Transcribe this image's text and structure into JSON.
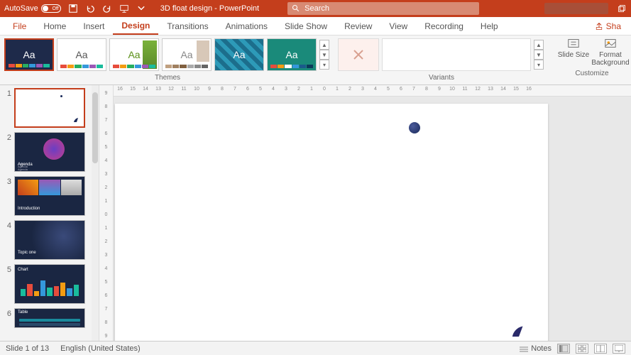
{
  "titlebar": {
    "autosave_label": "AutoSave",
    "autosave_state": "Off",
    "doc_title": "3D float design - PowerPoint",
    "search_placeholder": "Search"
  },
  "tabs": {
    "file": "File",
    "home": "Home",
    "insert": "Insert",
    "design": "Design",
    "transitions": "Transitions",
    "animations": "Animations",
    "slideshow": "Slide Show",
    "review": "Review",
    "view": "View",
    "recording": "Recording",
    "help": "Help",
    "share": "Sha"
  },
  "ribbon": {
    "themes_label": "Themes",
    "variants_label": "Variants",
    "customize_label": "Customize",
    "slide_size": "Slide Size",
    "format_bg": "Format Background",
    "theme_glyph": "Aa"
  },
  "thumbnails": [
    {
      "num": "1",
      "title": "",
      "type": "blank"
    },
    {
      "num": "2",
      "title": "Agenda",
      "type": "agenda"
    },
    {
      "num": "3",
      "title": "Introduction",
      "type": "intro"
    },
    {
      "num": "4",
      "title": "Topic one",
      "type": "topic"
    },
    {
      "num": "5",
      "title": "Chart",
      "type": "chart"
    },
    {
      "num": "6",
      "title": "Table",
      "type": "table"
    }
  ],
  "hruler_ticks": [
    "16",
    "15",
    "14",
    "13",
    "12",
    "11",
    "10",
    "9",
    "8",
    "7",
    "6",
    "5",
    "4",
    "3",
    "2",
    "1",
    "0",
    "1",
    "2",
    "3",
    "4",
    "5",
    "6",
    "7",
    "8",
    "9",
    "10",
    "11",
    "12",
    "13",
    "14",
    "15",
    "16"
  ],
  "vruler_ticks": [
    "9",
    "8",
    "7",
    "6",
    "5",
    "4",
    "3",
    "2",
    "1",
    "0",
    "1",
    "2",
    "3",
    "4",
    "5",
    "6",
    "7",
    "8",
    "9"
  ],
  "status": {
    "slide_info": "Slide 1 of 13",
    "language": "English (United States)",
    "notes": "Notes"
  },
  "colors": {
    "brand": "#c43e1c",
    "dark_slide": "#1a2642"
  }
}
